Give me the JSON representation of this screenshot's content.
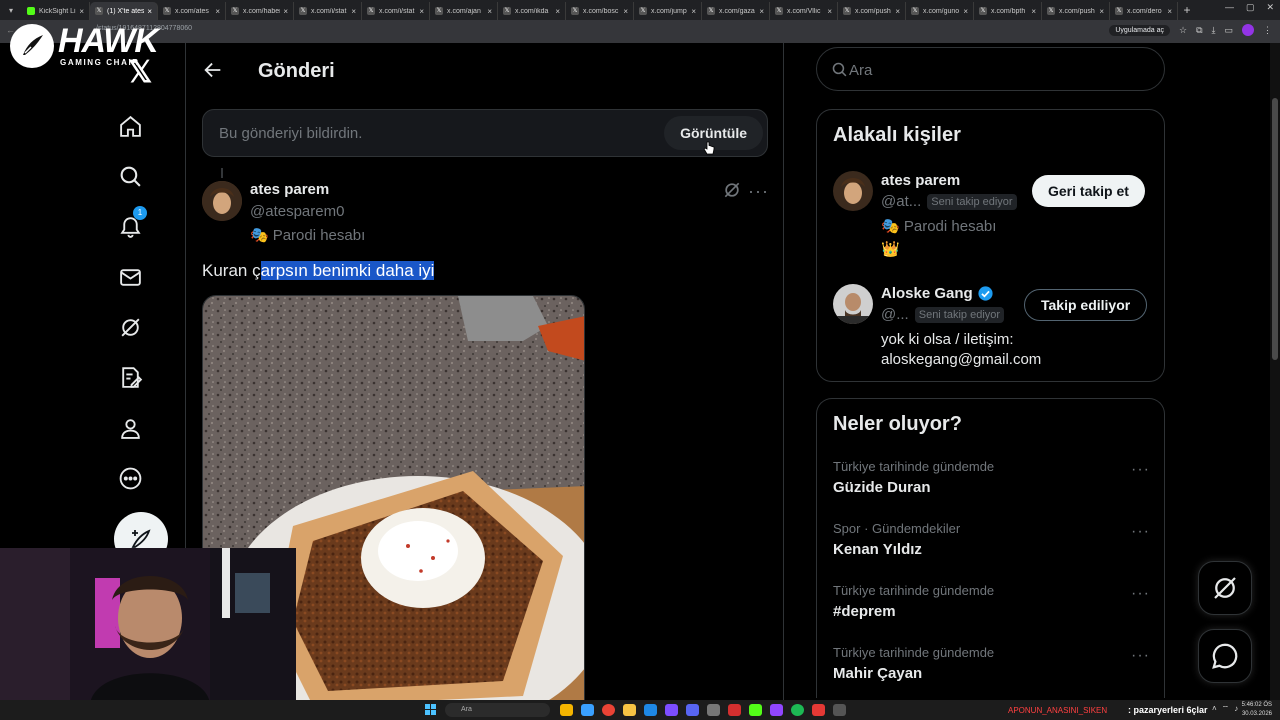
{
  "browser": {
    "tabs": [
      {
        "label": "KickSight Li",
        "active": false
      },
      {
        "label": "(1) X'te ates",
        "active": true
      },
      {
        "label": "x.com/ates",
        "active": false
      },
      {
        "label": "x.com/haber",
        "active": false
      },
      {
        "label": "x.com/i/stat",
        "active": false
      },
      {
        "label": "x.com/i/stat",
        "active": false
      },
      {
        "label": "x.com/ajan",
        "active": false
      },
      {
        "label": "x.com/ikda",
        "active": false
      },
      {
        "label": "x.com/bosc",
        "active": false
      },
      {
        "label": "x.com/jump",
        "active": false
      },
      {
        "label": "x.com/gaza",
        "active": false
      },
      {
        "label": "x.com/Vllic",
        "active": false
      },
      {
        "label": "x.com/push",
        "active": false
      },
      {
        "label": "x.com/guno",
        "active": false
      },
      {
        "label": "x.com/bpth",
        "active": false
      },
      {
        "label": "x.com/push",
        "active": false
      },
      {
        "label": "x.com/dero",
        "active": false
      }
    ],
    "url": "/status/1916487112804778060",
    "app_button": "Uygulamada aç"
  },
  "overlay_logo": {
    "title": "HAWK",
    "subtitle": "GAMING CHAIR"
  },
  "nav": {
    "notifications_badge": "1"
  },
  "main": {
    "title": "Gönderi",
    "notice": {
      "text": "Bu gönderiyi bildirdin.",
      "button": "Görüntüle"
    },
    "tweet": {
      "name": "ates parem",
      "handle": "@atesparem0",
      "parody_label": "Parodi hesabı",
      "text_plain": "Kuran ç",
      "text_selected": "arpsın benimki daha iyi"
    }
  },
  "sidebar": {
    "search_placeholder": "Ara",
    "relevant": {
      "title": "Alakalı kişiler",
      "people": [
        {
          "name": "ates parem",
          "handle": "@at...",
          "follows_you": "Seni takip ediyor",
          "parody_label": "Parodi hesabı",
          "emoji": "👑",
          "button": "Geri takip et",
          "verified": false
        },
        {
          "name": "Aloske Gang",
          "handle": "@...",
          "follows_you": "Seni takip ediyor",
          "bio_line1": "yok ki olsa / iletişim:",
          "bio_line2": "aloskegang@gmail.com",
          "button": "Takip ediliyor",
          "verified": true
        }
      ]
    },
    "trends": {
      "title": "Neler oluyor?",
      "items": [
        {
          "meta": "Türkiye tarihinde gündemde",
          "name": "Güzide Duran"
        },
        {
          "meta": "Spor · Gündemdekiler",
          "name": "Kenan Yıldız"
        },
        {
          "meta": "Türkiye tarihinde gündemde",
          "name": "#deprem"
        },
        {
          "meta": "Türkiye tarihinde gündemde",
          "name": "Mahir Çayan"
        }
      ]
    }
  },
  "taskbar": {
    "search": "Ara",
    "ticker_red": "APONUN_ANASINI_SIKEN",
    "ticker_white": ": pazaryerleri 6çlar",
    "time": "5:46:02 ÖS",
    "date": "30.03.2026"
  },
  "colors": {
    "accent": "#1d9bf0",
    "background": "#000000",
    "border": "#2f3336",
    "secondary_text": "#71767b",
    "selection": "#1a57c8"
  }
}
